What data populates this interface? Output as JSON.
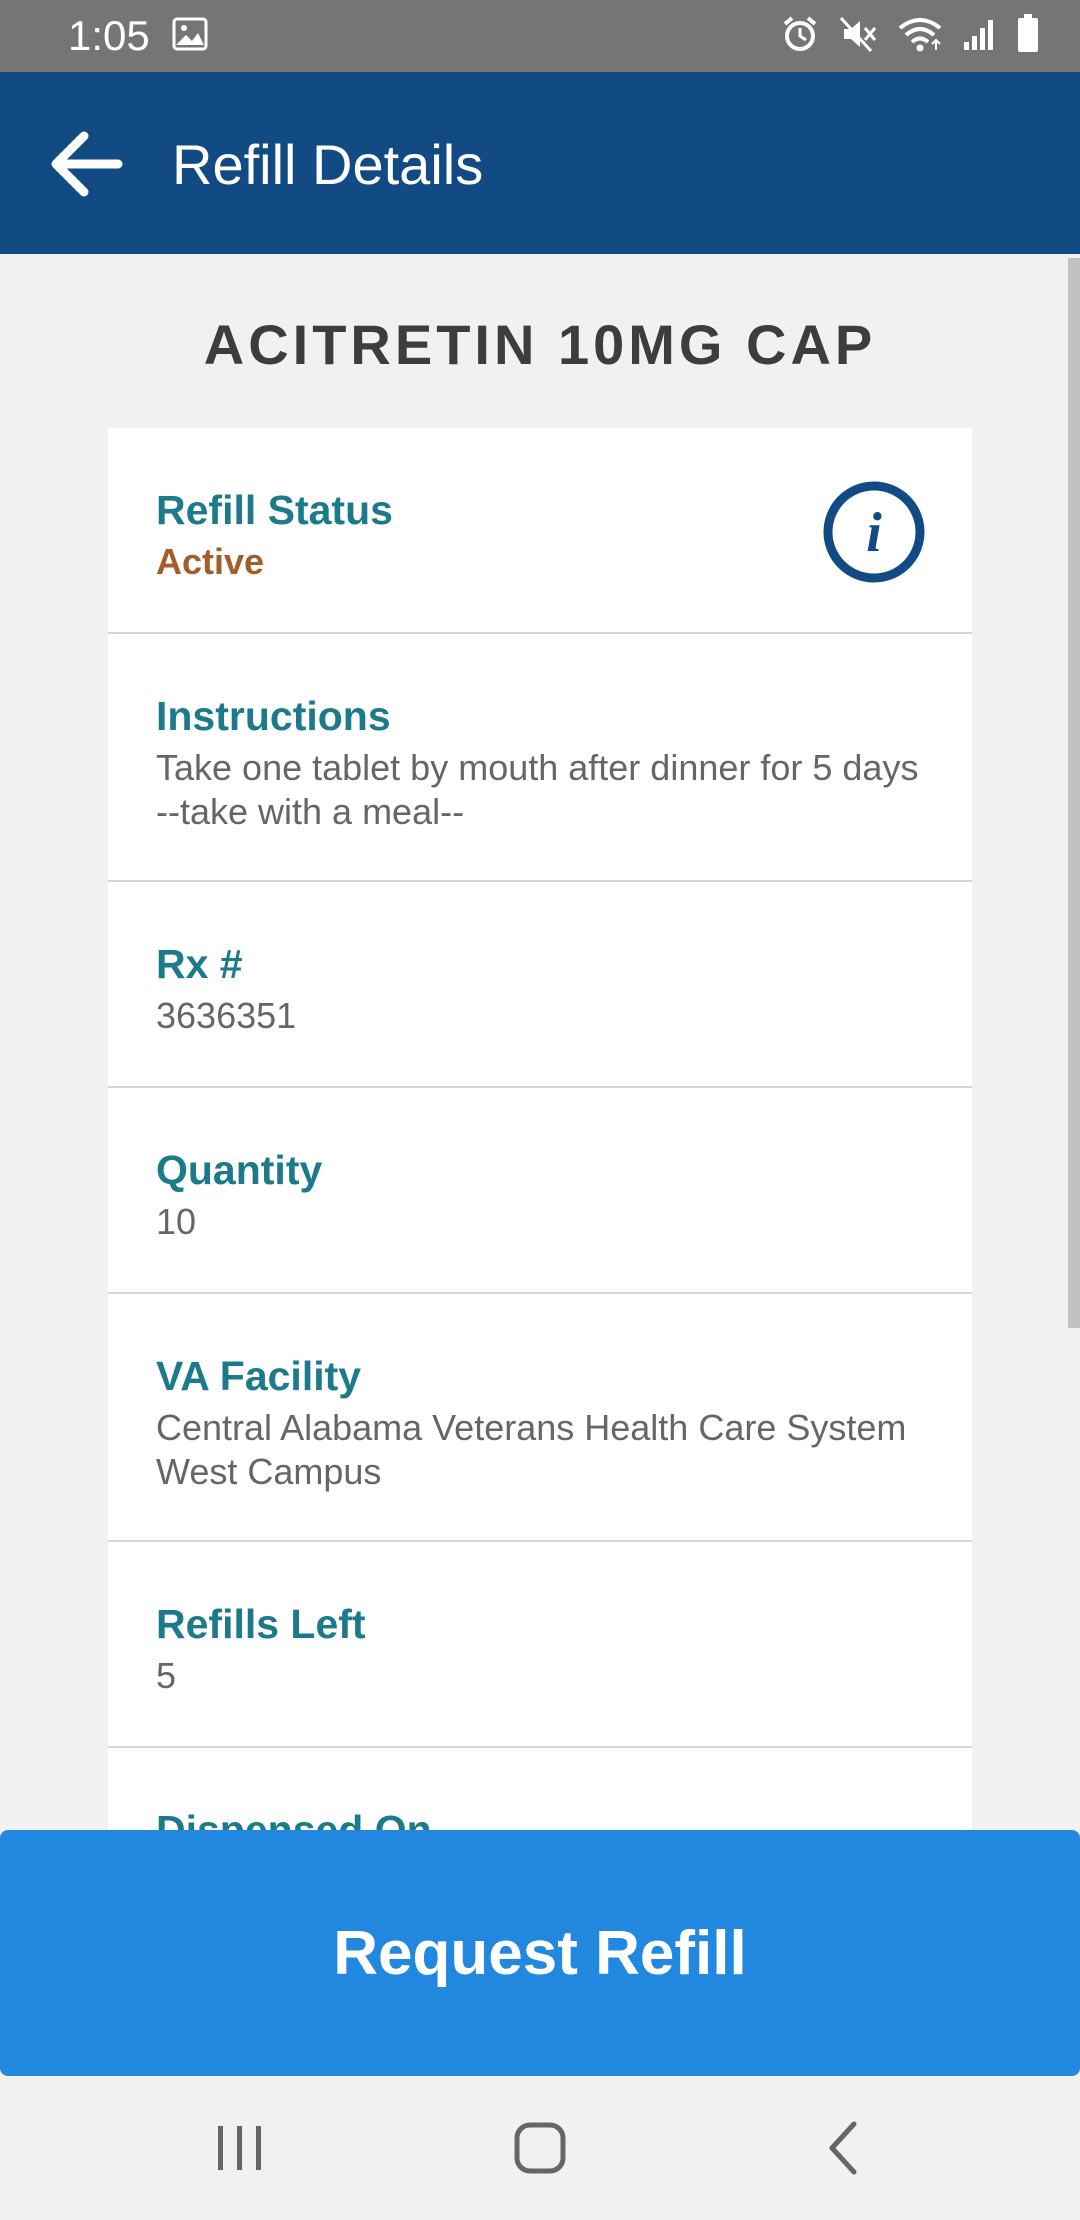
{
  "status_bar": {
    "time": "1:05",
    "icons": [
      "image-icon",
      "alarm-icon",
      "mute-icon",
      "wifi-icon",
      "signal-icon",
      "battery-icon"
    ]
  },
  "app_bar": {
    "title": "Refill Details",
    "back_icon": "back-arrow-icon"
  },
  "drug": {
    "name": "ACITRETIN 10MG CAP"
  },
  "details": [
    {
      "label": "Refill Status",
      "value": "Active"
    },
    {
      "label": "Instructions",
      "value": "Take one tablet by mouth after dinner for 5 days --take with a meal--"
    },
    {
      "label": "Rx #",
      "value": "3636351"
    },
    {
      "label": "Quantity",
      "value": "10"
    },
    {
      "label": "VA Facility",
      "value": "Central Alabama Veterans Health Care System West Campus"
    },
    {
      "label": "Refills Left",
      "value": "5"
    },
    {
      "label": "Dispensed On",
      "value": ""
    }
  ],
  "action": {
    "request_refill_label": "Request Refill"
  },
  "colors": {
    "app_bar": "#124b84",
    "label_teal": "#1c7a8b",
    "status_orange": "#a35d2a",
    "button_blue": "#2187df"
  },
  "nav_bar": {
    "icons": [
      "recent-apps-icon",
      "home-icon",
      "back-icon"
    ]
  }
}
